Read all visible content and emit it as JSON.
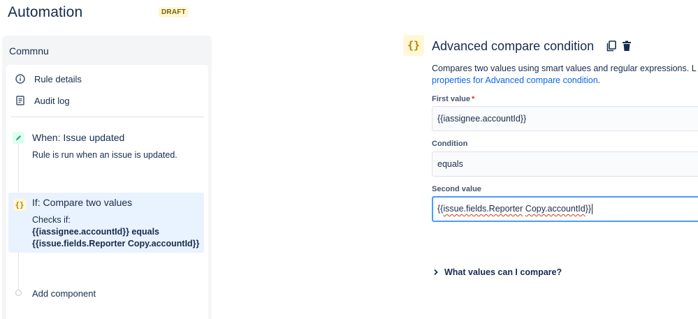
{
  "header": {
    "title": "Automation",
    "status_badge": "DRAFT"
  },
  "rule": {
    "name": "Commnu",
    "menu": [
      {
        "label": "Rule details",
        "icon": "info-icon"
      },
      {
        "label": "Audit log",
        "icon": "document-icon"
      }
    ],
    "trigger": {
      "title": "When: Issue updated",
      "description": "Rule is run when an issue is updated.",
      "icon": "pencil-icon"
    },
    "condition": {
      "title": "If: Compare two values",
      "checks_label": "Checks if:",
      "line1": "{{iassignee.accountId}} equals",
      "line2": "{{issue.fields.Reporter Copy.accountId}}",
      "icon": "curly-braces-icon"
    },
    "add_component_label": "Add component"
  },
  "component": {
    "icon_glyph": "{}",
    "title": "Advanced compare condition",
    "description_text": "Compares two values using smart values and regular expressions. L",
    "description_link": "properties for Advanced compare condition",
    "description_end": ".",
    "fields": {
      "first": {
        "label": "First value",
        "required_mark": "*",
        "value": "{{iassignee.accountId}}"
      },
      "condition": {
        "label": "Condition",
        "value": "equals"
      },
      "second": {
        "label": "Second value",
        "value_start": "{{",
        "value_issue": "issue.fields.Reporter",
        "value_space": " ",
        "value_copy": "Copy.accountId",
        "value_end": "}}"
      }
    },
    "help_toggle": "What values can I compare?"
  },
  "colors": {
    "accent": "#0c66e4",
    "selection_bg": "#e9f2ff",
    "draft_bg": "#fff7d6",
    "trigger_bg": "#dcfff1",
    "focus_border": "#4c9aff"
  }
}
